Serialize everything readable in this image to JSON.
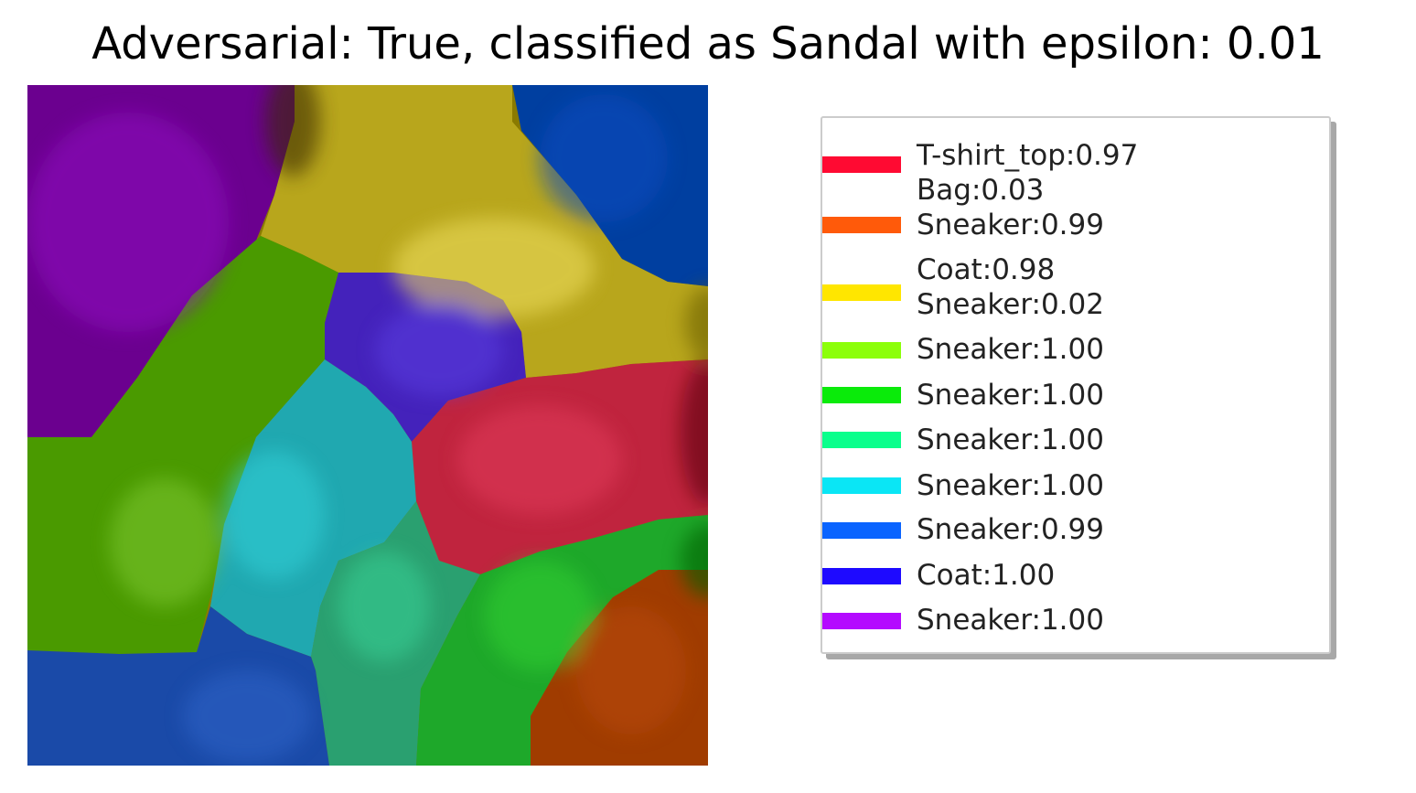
{
  "title": "Adversarial: True, classified as Sandal with epsilon: 0.01",
  "legend": {
    "items": [
      {
        "color": "#ff0a32",
        "lines": [
          "T-shirt_top:0.97",
          "Bag:0.03"
        ]
      },
      {
        "color": "#ff5a0a",
        "lines": [
          "Sneaker:0.99"
        ]
      },
      {
        "color": "#ffe600",
        "lines": [
          "Coat:0.98",
          "Sneaker:0.02"
        ]
      },
      {
        "color": "#8cff0a",
        "lines": [
          "Sneaker:1.00"
        ]
      },
      {
        "color": "#0aeb0a",
        "lines": [
          "Sneaker:1.00"
        ]
      },
      {
        "color": "#0aff8c",
        "lines": [
          "Sneaker:1.00"
        ]
      },
      {
        "color": "#0ae6f5",
        "lines": [
          "Sneaker:1.00"
        ]
      },
      {
        "color": "#0a64ff",
        "lines": [
          "Sneaker:0.99"
        ]
      },
      {
        "color": "#1e0aff",
        "lines": [
          "Coat:1.00"
        ]
      },
      {
        "color": "#b40aff",
        "lines": [
          "Sneaker:1.00"
        ]
      }
    ]
  }
}
